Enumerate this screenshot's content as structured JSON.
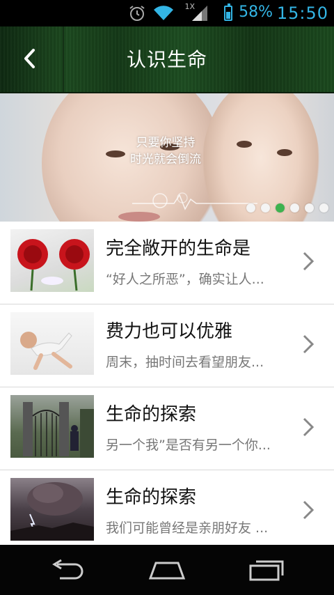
{
  "status_bar": {
    "time": "15:50",
    "battery_percent": "58%",
    "network_type": "1X",
    "icons": [
      "alarm-icon",
      "wifi-icon",
      "signal-icon",
      "battery-icon"
    ],
    "accent_color": "#33b5e5"
  },
  "header": {
    "title": "认识生命",
    "back_icon": "chevron-left-icon"
  },
  "banner": {
    "line1": "只要你坚持",
    "line2": "时光就会倒流",
    "page_count": 6,
    "active_index": 2,
    "active_color": "#3db24f"
  },
  "articles": [
    {
      "title": "完全敞开的生命是",
      "summary": "“好人之所恶”，确实让人...",
      "thumb": "red-roses-image"
    },
    {
      "title": "费力也可以优雅",
      "summary": "周末，抽时间去看望朋友...",
      "thumb": "baby-crawling-image"
    },
    {
      "title": "生命的探索",
      "summary": "另一个我”是否有另一个你...",
      "thumb": "garden-gate-image"
    },
    {
      "title": "生命的探索",
      "summary": "我们可能曾经是亲朋好友 ...",
      "thumb": "volcano-lightning-image"
    }
  ],
  "nav_bar": {
    "buttons": [
      "back-icon",
      "home-icon",
      "recent-apps-icon"
    ]
  }
}
